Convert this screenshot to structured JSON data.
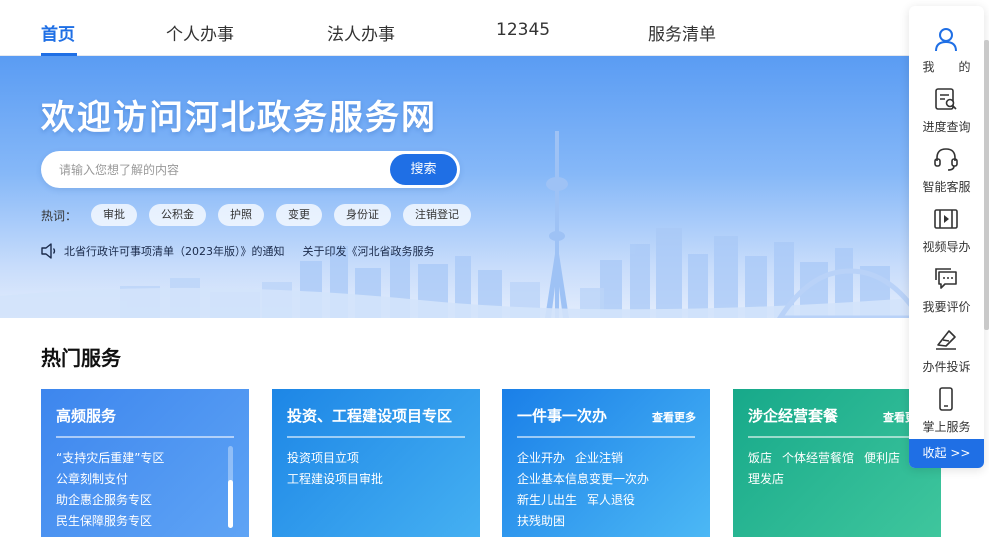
{
  "nav": {
    "items": [
      "首页",
      "个人办事",
      "法人办事",
      "12345",
      "服务清单"
    ]
  },
  "hero": {
    "title": "欢迎访问河北政务服务网",
    "search_placeholder": "请输入您想了解的内容",
    "search_button": "搜索",
    "hot_label": "热词：",
    "hot_tags": [
      "审批",
      "公积金",
      "护照",
      "变更",
      "身份证",
      "注销登记"
    ],
    "notice_1": "北省行政许可事项清单（2023年版）》的通知",
    "notice_2": "关于印发《河北省政务服务（"
  },
  "section": {
    "title": "热门服务"
  },
  "cards": [
    {
      "title": "高频服务",
      "more": "",
      "rows": [
        [
          "“支持灾后重建”专区"
        ],
        [
          "公章刻制支付"
        ],
        [
          "助企惠企服务专区"
        ],
        [
          "民生保障服务专区"
        ]
      ]
    },
    {
      "title": "投资、工程建设项目专区",
      "more": "",
      "rows": [
        [
          "投资项目立项"
        ],
        [
          "工程建设项目审批"
        ]
      ]
    },
    {
      "title": "一件事一次办",
      "more": "查看更多",
      "rows": [
        [
          "企业开办",
          "企业注销"
        ],
        [
          "企业基本信息变更一次办"
        ],
        [
          "新生儿出生",
          "军人退役"
        ],
        [
          "扶残助困"
        ]
      ]
    },
    {
      "title": "涉企经营套餐",
      "more": "查看更",
      "rows": [
        [
          "饭店",
          "个体经营餐馆",
          "便利店"
        ],
        [
          "理发店"
        ]
      ]
    }
  ],
  "sidebar": {
    "items": [
      "我　　的",
      "进度查询",
      "智能客服",
      "视频导办",
      "我要评价",
      "办件投诉",
      "掌上服务"
    ],
    "collapse": "收起 >>"
  },
  "colors": {
    "primary": "#1f6fe5",
    "hero_top": "#5a9cf3",
    "card_green": "#17a98a"
  }
}
